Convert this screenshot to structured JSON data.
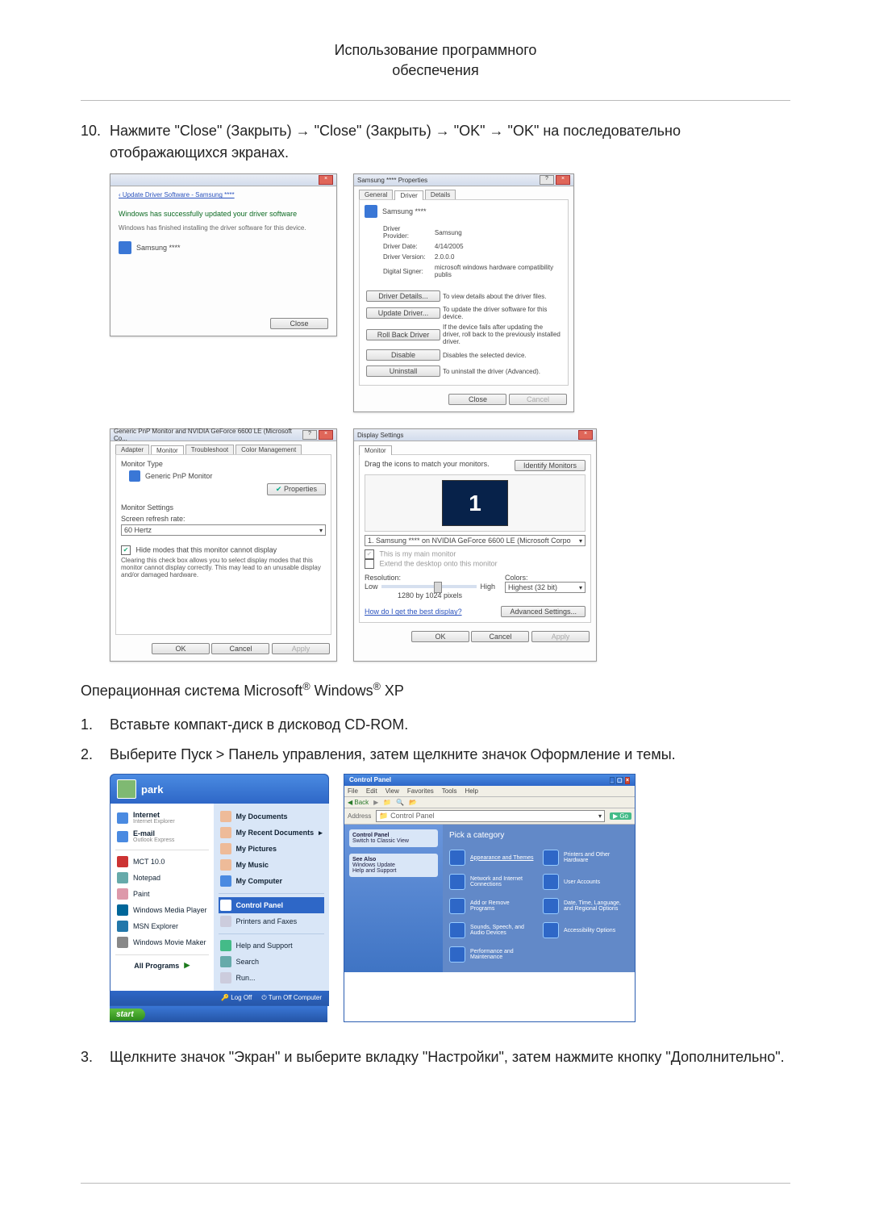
{
  "header": {
    "line1": "Использование программного",
    "line2": "обеспечения"
  },
  "step10": {
    "num": "10.",
    "text": "Нажмите \"Close\" (Закрыть) → \"Close\" (Закрыть) → \"OK\" → \"OK\" на последовательно отображающихся экранах."
  },
  "shot1": {
    "breadcrumb": "‹ Update Driver Software - Samsung ****",
    "headline": "Windows has successfully updated your driver software",
    "sub": "Windows has finished installing the driver software for this device.",
    "device": "Samsung ****",
    "close": "Close"
  },
  "shot2": {
    "title": "Samsung **** Properties",
    "tab_general": "General",
    "tab_driver": "Driver",
    "tab_details": "Details",
    "device": "Samsung ****",
    "rows": {
      "provider_l": "Driver Provider:",
      "provider_v": "Samsung",
      "date_l": "Driver Date:",
      "date_v": "4/14/2005",
      "version_l": "Driver Version:",
      "version_v": "2.0.0.0",
      "signer_l": "Digital Signer:",
      "signer_v": "microsoft windows hardware compatibility publis"
    },
    "btns": {
      "details": "Driver Details...",
      "details_d": "To view details about the driver files.",
      "update": "Update Driver...",
      "update_d": "To update the driver software for this device.",
      "rollback": "Roll Back Driver",
      "rollback_d": "If the device fails after updating the driver, roll back to the previously installed driver.",
      "disable": "Disable",
      "disable_d": "Disables the selected device.",
      "uninstall": "Uninstall",
      "uninstall_d": "To uninstall the driver (Advanced)."
    },
    "close": "Close",
    "cancel": "Cancel"
  },
  "shot3": {
    "title": "Generic PnP Monitor and NVIDIA GeForce 6600 LE (Microsoft Co...",
    "tab_adapter": "Adapter",
    "tab_monitor": "Monitor",
    "tab_trouble": "Troubleshoot",
    "tab_color": "Color Management",
    "mon_type_h": "Monitor Type",
    "mon_type_v": "Generic PnP Monitor",
    "properties": "Properties",
    "mon_set_h": "Monitor Settings",
    "refresh_l": "Screen refresh rate:",
    "refresh_v": "60 Hertz",
    "hide": "Hide modes that this monitor cannot display",
    "hide_help": "Clearing this check box allows you to select display modes that this monitor cannot display correctly. This may lead to an unusable display and/or damaged hardware.",
    "ok": "OK",
    "cancel": "Cancel",
    "apply": "Apply"
  },
  "shot4": {
    "title": "Display Settings",
    "tab_monitor": "Monitor",
    "drag": "Drag the icons to match your monitors.",
    "identify": "Identify Monitors",
    "list": "1. Samsung **** on NVIDIA GeForce 6600 LE (Microsoft Corpo",
    "main_chk": "This is my main monitor",
    "extend_chk": "Extend the desktop onto this monitor",
    "res_l": "Resolution:",
    "colors_l": "Colors:",
    "low": "Low",
    "high": "High",
    "res_v": "1280 by 1024 pixels",
    "colors_v": "Highest (32 bit)",
    "best": "How do I get the best display?",
    "adv": "Advanced Settings...",
    "ok": "OK",
    "cancel": "Cancel",
    "apply": "Apply"
  },
  "midtext": {
    "os_line_pre": "Операционная система Microsoft",
    "os_line_mid": " Windows",
    "os_line_post": " XP",
    "reg": "®"
  },
  "step1": {
    "num": "1.",
    "text": "Вставьте компакт-диск в дисковод CD-ROM."
  },
  "step2": {
    "num": "2.",
    "text": "Выберите Пуск > Панель управления, затем щелкните значок Оформление и темы."
  },
  "xp_start": {
    "user": "park",
    "left": {
      "internet": "Internet",
      "internet_sub": "Internet Explorer",
      "email": "E-mail",
      "email_sub": "Outlook Express",
      "mct": "MCT 10.0",
      "notepad": "Notepad",
      "paint": "Paint",
      "wmp": "Windows Media Player",
      "msn": "MSN Explorer",
      "wmm": "Windows Movie Maker",
      "allprog": "All Programs"
    },
    "right": {
      "mydocs": "My Documents",
      "recent": "My Recent Documents",
      "pics": "My Pictures",
      "music": "My Music",
      "comp": "My Computer",
      "cp": "Control Panel",
      "printers": "Printers and Faxes",
      "help": "Help and Support",
      "search": "Search",
      "run": "Run..."
    },
    "logoff": "Log Off",
    "shutdown": "Turn Off Computer",
    "start": "start"
  },
  "xp_cp": {
    "title": "Control Panel",
    "menu": {
      "file": "File",
      "edit": "Edit",
      "view": "View",
      "fav": "Favorites",
      "tools": "Tools",
      "help": "Help"
    },
    "nav": {
      "back": "Back",
      "addr_lbl": "Address",
      "addr_v": "Control Panel"
    },
    "side": {
      "p1_title": "Control Panel",
      "p1_i1": "Switch to Classic View",
      "p2_title": "See Also",
      "p2_i1": "Windows Update",
      "p2_i2": "Help and Support"
    },
    "main": {
      "header": "Pick a category",
      "c1": "Appearance and Themes",
      "c2": "Printers and Other Hardware",
      "c3": "Network and Internet Connections",
      "c4": "User Accounts",
      "c5": "Add or Remove Programs",
      "c6": "Date, Time, Language, and Regional Options",
      "c7": "Sounds, Speech, and Audio Devices",
      "c8": "Accessibility Options",
      "c9": "Performance and Maintenance"
    }
  },
  "step3": {
    "num": "3.",
    "text": "Щелкните значок \"Экран\" и выберите вкладку \"Настройки\", затем нажмите кнопку \"Дополнительно\"."
  }
}
